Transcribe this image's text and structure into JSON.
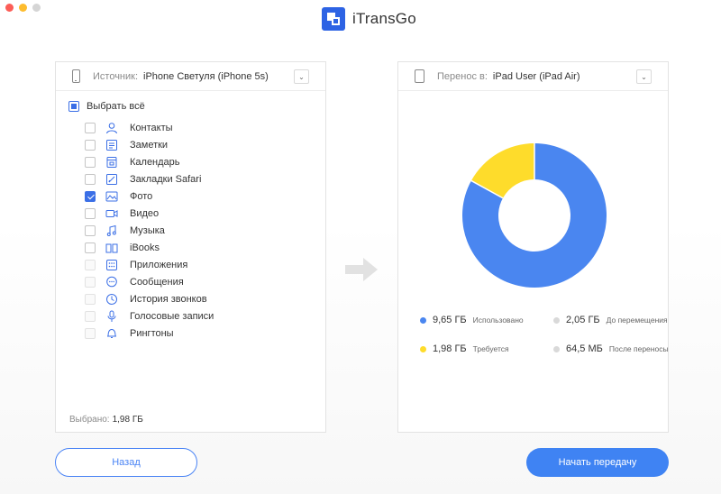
{
  "app": {
    "title": "iTransGo"
  },
  "source": {
    "label": "Источник:",
    "device": "iPhone Светуля (iPhone 5s)",
    "select_all": "Выбрать всё",
    "items": [
      {
        "label": "Контакты",
        "icon": "contacts-icon",
        "state": "unchecked"
      },
      {
        "label": "Заметки",
        "icon": "notes-icon",
        "state": "unchecked"
      },
      {
        "label": "Календарь",
        "icon": "calendar-icon",
        "state": "unchecked"
      },
      {
        "label": "Закладки Safari",
        "icon": "bookmarks-icon",
        "state": "unchecked"
      },
      {
        "label": "Фото",
        "icon": "photo-icon",
        "state": "checked"
      },
      {
        "label": "Видео",
        "icon": "video-icon",
        "state": "unchecked"
      },
      {
        "label": "Музыка",
        "icon": "music-icon",
        "state": "unchecked"
      },
      {
        "label": "iBooks",
        "icon": "ibooks-icon",
        "state": "unchecked"
      },
      {
        "label": "Приложения",
        "icon": "apps-icon",
        "state": "disabled"
      },
      {
        "label": "Сообщения",
        "icon": "messages-icon",
        "state": "disabled"
      },
      {
        "label": "История звонков",
        "icon": "call-history-icon",
        "state": "disabled"
      },
      {
        "label": "Голосовые записи",
        "icon": "voice-memos-icon",
        "state": "disabled"
      },
      {
        "label": "Рингтоны",
        "icon": "ringtones-icon",
        "state": "disabled"
      }
    ],
    "selected_label": "Выбрано:",
    "selected_value": "1,98 ГБ"
  },
  "target": {
    "label": "Перенос в:",
    "device": "iPad User (iPad Air)",
    "legend": [
      {
        "value": "9,65 ГБ",
        "label": "Использовано",
        "color": "#4a86f0"
      },
      {
        "value": "2,05 ГБ",
        "label": "До перемещения",
        "color": "#d9d9d9"
      },
      {
        "value": "1,98 ГБ",
        "label": "Требуется",
        "color": "#fedc2b"
      },
      {
        "value": "64,5 МБ",
        "label": "После переносы",
        "color": "#d9d9d9"
      }
    ],
    "chart_segments": [
      {
        "name": "Использовано",
        "fraction": 0.83,
        "color": "#4a86f0"
      },
      {
        "name": "Требуется",
        "fraction": 0.17,
        "color": "#fedc2b"
      }
    ]
  },
  "buttons": {
    "back": "Назад",
    "start": "Начать передачу"
  },
  "colors": {
    "accent": "#3f83f3",
    "checkbox": "#3b6fe6"
  }
}
